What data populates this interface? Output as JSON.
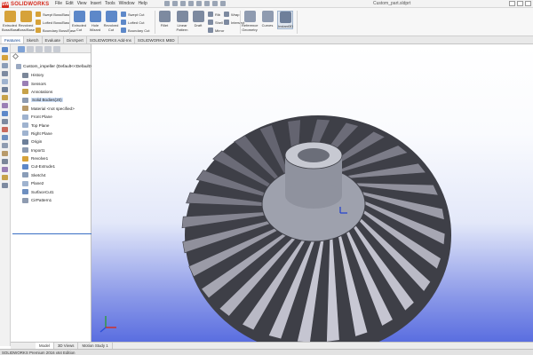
{
  "app": {
    "logo_text": "SOLIDWORKS",
    "logo_mark": "SW",
    "document_title": "Custom_part.sldprt",
    "menus": [
      "File",
      "Edit",
      "View",
      "Insert",
      "Tools",
      "Window",
      "Help"
    ]
  },
  "ribbon": {
    "big_buttons": [
      {
        "label": "Extruded Boss/Base",
        "icon": "extrude-boss-icon",
        "color": "#d6a23a"
      },
      {
        "label": "Revolved Boss/Base",
        "icon": "revolve-boss-icon",
        "color": "#d6a23a"
      },
      {
        "label": "Extruded Cut",
        "icon": "extrude-cut-icon",
        "color": "#5d88c9"
      },
      {
        "label": "Hole Wizard",
        "icon": "hole-wizard-icon",
        "color": "#5d88c9"
      },
      {
        "label": "Revolved Cut",
        "icon": "revolve-cut-icon",
        "color": "#5d88c9"
      },
      {
        "label": "Fillet",
        "icon": "fillet-icon",
        "color": "#7d8aa0"
      },
      {
        "label": "Linear Pattern",
        "icon": "linear-pattern-icon",
        "color": "#7d8aa0"
      },
      {
        "label": "Draft",
        "icon": "draft-icon",
        "color": "#7d8aa0"
      },
      {
        "label": "Reference Geometry",
        "icon": "reference-geometry-icon",
        "color": "#8f9bb0"
      },
      {
        "label": "Curves",
        "icon": "curves-icon",
        "color": "#8f9bb0"
      },
      {
        "label": "Instant3D",
        "icon": "instant3d-icon",
        "color": "#6e7f9a"
      }
    ],
    "small_buttons": [
      {
        "label": "Swept Boss/Base",
        "icon": "swept-boss-icon",
        "color": "#d6a23a"
      },
      {
        "label": "Lofted Boss/Base",
        "icon": "lofted-boss-icon",
        "color": "#d6a23a"
      },
      {
        "label": "Boundary Boss/Base",
        "icon": "boundary-boss-icon",
        "color": "#d6a23a"
      },
      {
        "label": "Swept Cut",
        "icon": "swept-cut-icon",
        "color": "#5d88c9"
      },
      {
        "label": "Lofted Cut",
        "icon": "lofted-cut-icon",
        "color": "#5d88c9"
      },
      {
        "label": "Boundary Cut",
        "icon": "boundary-cut-icon",
        "color": "#5d88c9"
      },
      {
        "label": "Rib",
        "icon": "rib-icon",
        "color": "#7d8aa0"
      },
      {
        "label": "Shell",
        "icon": "shell-icon",
        "color": "#7d8aa0"
      },
      {
        "label": "Mirror",
        "icon": "mirror-icon",
        "color": "#7d8aa0"
      },
      {
        "label": "Wrap",
        "icon": "wrap-icon",
        "color": "#7d8aa0"
      },
      {
        "label": "Intersect",
        "icon": "intersect-icon",
        "color": "#7d8aa0"
      }
    ]
  },
  "tabs": [
    "Features",
    "Sketch",
    "Evaluate",
    "DimXpert",
    "SOLIDWORKS Add-Ins",
    "SOLIDWORKS MBD"
  ],
  "active_tab": "Features",
  "tree": {
    "root": "Custom_impeller (Default<<Default>_D",
    "items": [
      {
        "label": "History",
        "icon": "history-icon",
        "color": "#7b8799"
      },
      {
        "label": "Sensors",
        "icon": "sensors-icon",
        "color": "#9a7fb5"
      },
      {
        "label": "Annotations",
        "icon": "annotations-icon",
        "color": "#c7a24a"
      },
      {
        "label": "Solid Bodies(20)",
        "icon": "solid-bodies-icon",
        "color": "#8e9bb0"
      },
      {
        "label": "Material <not specified>",
        "icon": "material-icon",
        "color": "#b89a6a"
      },
      {
        "label": "Front Plane",
        "icon": "plane-icon",
        "color": "#9fb3cf"
      },
      {
        "label": "Top Plane",
        "icon": "plane-icon",
        "color": "#9fb3cf"
      },
      {
        "label": "Right Plane",
        "icon": "plane-icon",
        "color": "#9fb3cf"
      },
      {
        "label": "Origin",
        "icon": "origin-icon",
        "color": "#6d7f99"
      },
      {
        "label": "Import1",
        "icon": "import-icon",
        "color": "#8c9ab0"
      },
      {
        "label": "Revolve1",
        "icon": "revolve-icon",
        "color": "#d6a23a"
      },
      {
        "label": "Cut-Extrude1",
        "icon": "cut-extrude-icon",
        "color": "#5d88c9"
      },
      {
        "label": "Sketch4",
        "icon": "sketch-icon",
        "color": "#8a9db8"
      },
      {
        "label": "Plane2",
        "icon": "plane-icon",
        "color": "#9fb3cf"
      },
      {
        "label": "SurfaceCut1",
        "icon": "surface-cut-icon",
        "color": "#6e8fc0"
      },
      {
        "label": "CirPattern1",
        "icon": "circular-pattern-icon",
        "color": "#8e9bb0"
      }
    ],
    "highlighted_index": 3
  },
  "left_strip_icons": [
    {
      "icon": "home-icon",
      "color": "#5d88c9"
    },
    {
      "icon": "features-icon",
      "color": "#d6a23a"
    },
    {
      "icon": "sketch-icon",
      "color": "#8a9db8"
    },
    {
      "icon": "curve-icon",
      "color": "#7d8aa0"
    },
    {
      "icon": "plane-icon",
      "color": "#9fb3cf"
    },
    {
      "icon": "axis-icon",
      "color": "#6e7f9a"
    },
    {
      "icon": "point-icon",
      "color": "#c7a24a"
    },
    {
      "icon": "mate-icon",
      "color": "#9a7fb5"
    },
    {
      "icon": "measure-icon",
      "color": "#5d88c9"
    },
    {
      "icon": "section-icon",
      "color": "#7d8aa0"
    },
    {
      "icon": "appearance-icon",
      "color": "#c96a5d"
    },
    {
      "icon": "scene-icon",
      "color": "#6e8fc0"
    },
    {
      "icon": "display-icon",
      "color": "#8e9bb0"
    },
    {
      "icon": "render-icon",
      "color": "#b89a6a"
    },
    {
      "icon": "camera-icon",
      "color": "#7b8799"
    },
    {
      "icon": "decal-icon",
      "color": "#9a7fb5"
    },
    {
      "icon": "light-icon",
      "color": "#c7a24a"
    },
    {
      "icon": "options-icon",
      "color": "#7d8aa0"
    }
  ],
  "model_tabs": [
    "Model",
    "3D Views",
    "Motion Study 1"
  ],
  "active_model_tab": "Model",
  "status": "SOLIDWORKS Premium 2016 x64 Edition",
  "colors": {
    "accent": "#d52b1e",
    "viewport_bottom": "#5a6ee0",
    "model_face": "#9ea1ad",
    "model_shadow": "#3e3f47"
  }
}
